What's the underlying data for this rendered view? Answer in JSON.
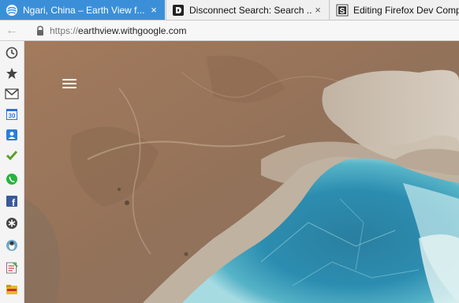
{
  "tabs": [
    {
      "title": "Ngari, China – Earth View f...",
      "icon": "earth-view-icon",
      "active": true,
      "closable": true
    },
    {
      "title": "Disconnect Search: Search ...",
      "icon": "disconnect-icon",
      "active": false,
      "closable": true
    },
    {
      "title": "Editing Firefox Dev Comp",
      "icon": "mdn-edit-icon",
      "active": false,
      "closable": false
    }
  ],
  "close_glyph": "×",
  "nav": {
    "back_glyph": "←",
    "url_scheme": "https://",
    "url_host": "earthview.withgoogle.com"
  },
  "sidebar": {
    "items": [
      {
        "icon": "history-icon"
      },
      {
        "icon": "bookmarks-star-icon"
      },
      {
        "icon": "gmail-icon"
      },
      {
        "icon": "calendar-icon",
        "label": "30"
      },
      {
        "icon": "contacts-icon"
      },
      {
        "icon": "checkmark-icon"
      },
      {
        "icon": "whatsapp-icon"
      },
      {
        "icon": "facebook-icon",
        "label": "f"
      },
      {
        "icon": "asterisk-app-icon"
      },
      {
        "icon": "penguin-app-icon"
      },
      {
        "icon": "notes-app-icon"
      },
      {
        "icon": "folder-app-icon"
      }
    ]
  },
  "earth_view": {
    "location": "Ngari, China",
    "colors": {
      "desert": "#9a7358",
      "lake_deep": "#2d86a8",
      "lake_shallow": "#8fd3e0",
      "salt": "#d9d4c8"
    }
  },
  "colors": {
    "active_tab": "#3b8fd9"
  }
}
